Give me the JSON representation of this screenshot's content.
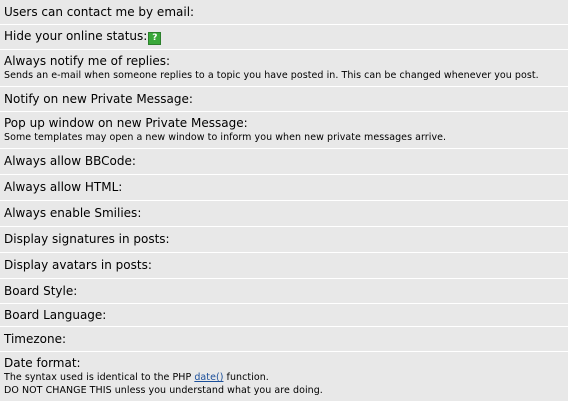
{
  "rows": [
    {
      "label": "Users can contact me by email:"
    },
    {
      "label": "Hide your online status:",
      "icon": "help-icon",
      "icon_text": "?"
    },
    {
      "label": "Always notify me of replies:",
      "desc": "Sends an e-mail when someone replies to a topic you have posted in. This can be changed whenever you post."
    },
    {
      "label": "Notify on new Private Message:"
    },
    {
      "label": "Pop up window on new Private Message:",
      "desc": "Some templates may open a new window to inform you when new private messages arrive."
    },
    {
      "label": "Always allow BBCode:"
    },
    {
      "label": "Always allow HTML:"
    },
    {
      "label": "Always enable Smilies:"
    },
    {
      "label": "Display signatures in posts:"
    },
    {
      "label": "Display avatars in posts:"
    },
    {
      "label": "Board Style:"
    },
    {
      "label": "Board Language:"
    },
    {
      "label": "Timezone:"
    },
    {
      "label": "Date format:",
      "desc_prefix": "The syntax used is identical to the PHP ",
      "desc_link": "date()",
      "desc_suffix": " function.",
      "desc2": "DO NOT CHANGE THIS unless you understand what you are doing."
    }
  ],
  "colors": {
    "row_bg": "#e8e8e8",
    "link": "#1a4e99",
    "help_icon": "#3aa83a"
  }
}
